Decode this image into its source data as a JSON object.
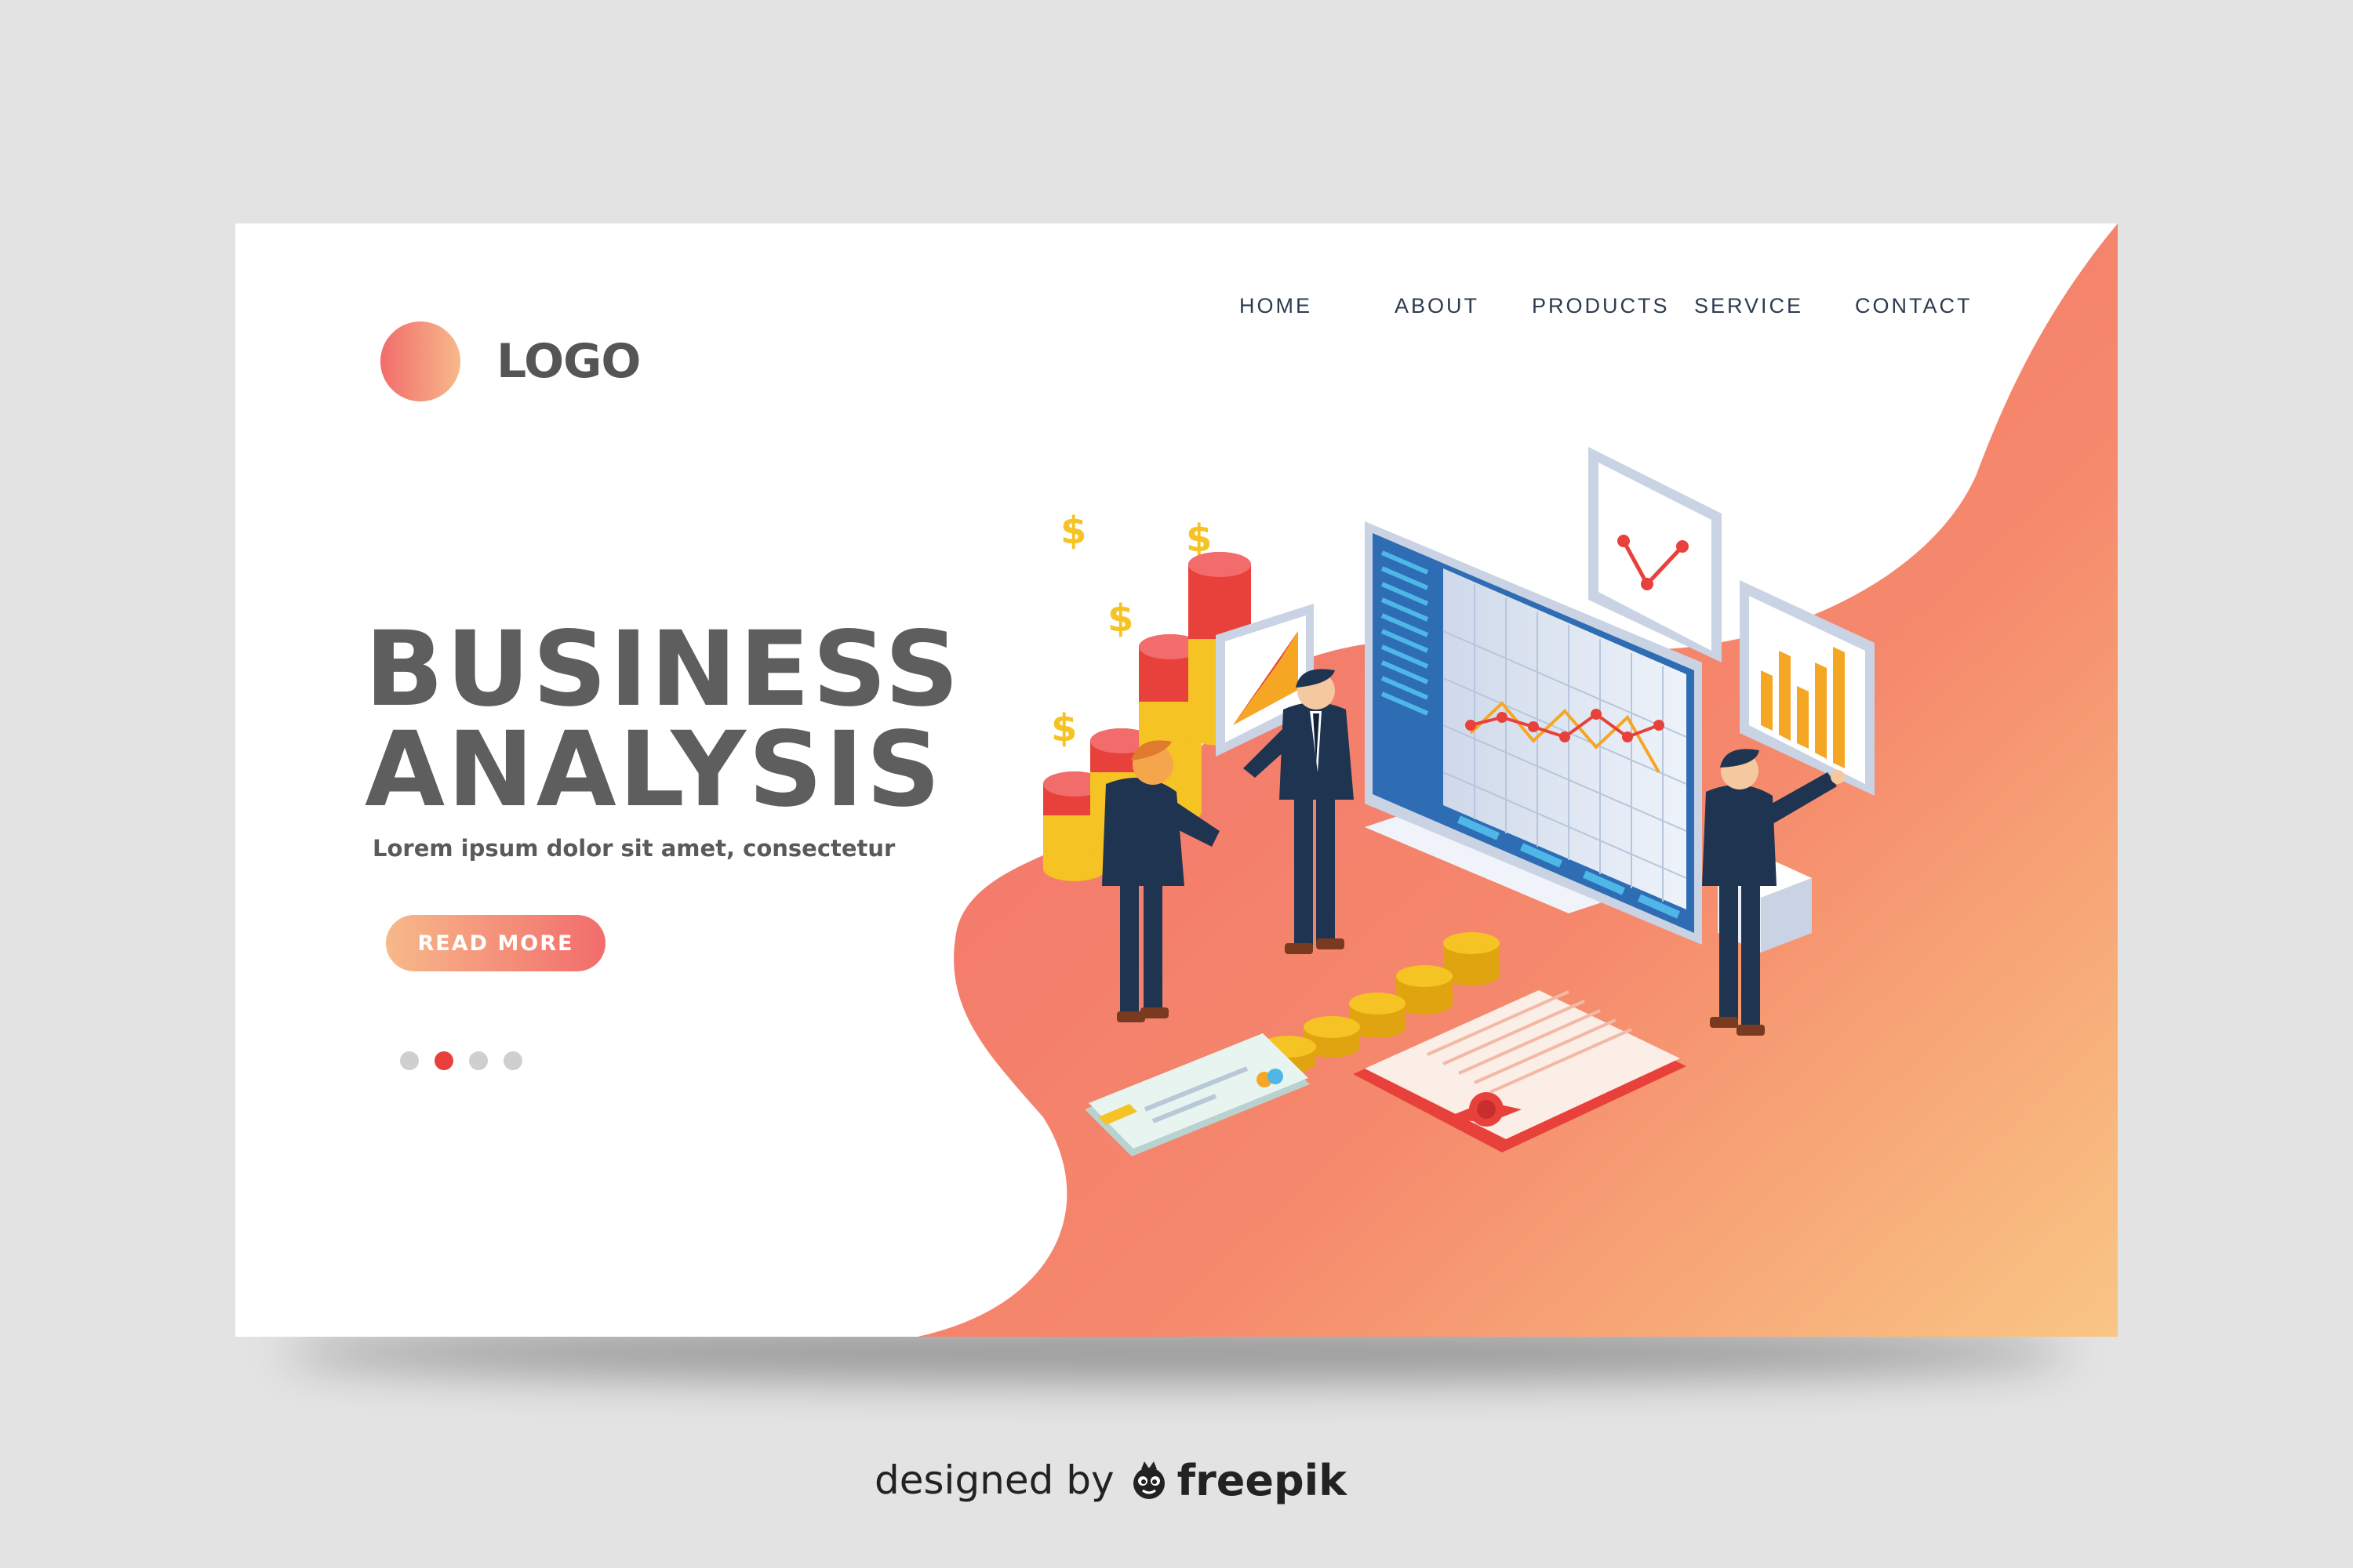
{
  "brand": {
    "logo_text": "LOGO"
  },
  "nav": {
    "items": [
      {
        "label": "HOME"
      },
      {
        "label": "ABOUT"
      },
      {
        "label": "PRODUCTS"
      },
      {
        "label": "SERVICE"
      },
      {
        "label": "CONTACT"
      }
    ]
  },
  "hero": {
    "title_line1": "BUSINESS",
    "title_line2": "ANALYSIS",
    "subtitle": "Lorem ipsum dolor sit amet, consectetur",
    "cta_label": "READ MORE"
  },
  "carousel": {
    "slide_count": 4,
    "active_slide": 2
  },
  "illustration": {
    "currency_symbol": "$",
    "icons": [
      "dollar-sign-icon",
      "coin-stack-icon",
      "credit-card-icon",
      "certificate-icon",
      "monitor-icon",
      "line-chart-icon",
      "bar-chart-icon",
      "businessman-icon"
    ]
  },
  "credit": {
    "prefix": "designed by",
    "brand": "freepik"
  },
  "colors": {
    "page_background": "#e3e3e3",
    "accent_red": "#e8413b",
    "gradient_start": "#f26c6c",
    "gradient_end": "#f9c684",
    "heading_gray": "#5e5e5e",
    "nav_text": "#2d3b4f",
    "suit_navy": "#1f3450",
    "coin_gold": "#f5c324"
  }
}
